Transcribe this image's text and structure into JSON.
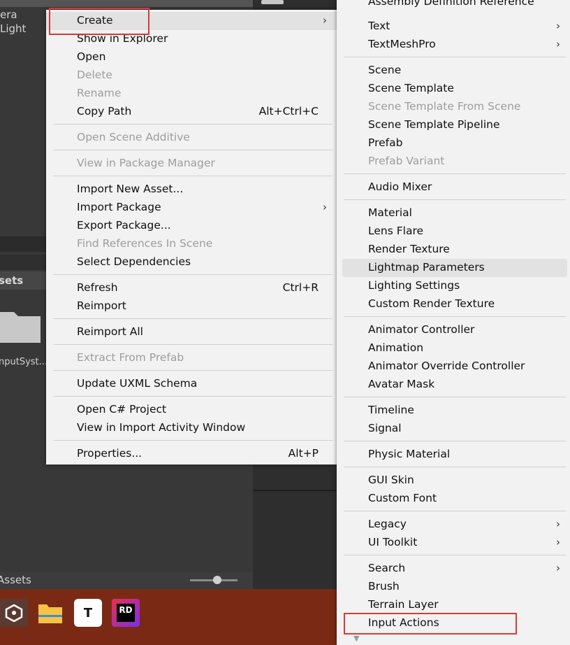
{
  "background": {
    "hierarchy_items": [
      "era",
      "Light"
    ],
    "project_header": "sets",
    "folder_label": "nputSyst...",
    "bottom_breadcrumb": "Assets"
  },
  "taskbar": {
    "icons": [
      "unity-icon",
      "folder-icon",
      "typora-icon",
      "rider-icon"
    ],
    "typora_glyph": "T",
    "rider_glyph": "RD"
  },
  "context_menu": {
    "items": [
      {
        "label": "Create",
        "submenu": true,
        "arrow": "›"
      },
      {
        "label": "Show in Explorer"
      },
      {
        "label": "Open"
      },
      {
        "label": "Delete",
        "disabled": true
      },
      {
        "label": "Rename",
        "disabled": true
      },
      {
        "label": "Copy Path",
        "shortcut": "Alt+Ctrl+C"
      },
      {
        "label": "Open Scene Additive",
        "disabled": true
      },
      {
        "label": "View in Package Manager",
        "disabled": true
      },
      {
        "label": "Import New Asset..."
      },
      {
        "label": "Import Package",
        "submenu": true,
        "arrow": "›"
      },
      {
        "label": "Export Package..."
      },
      {
        "label": "Find References In Scene",
        "disabled": true
      },
      {
        "label": "Select Dependencies"
      },
      {
        "label": "Refresh",
        "shortcut": "Ctrl+R"
      },
      {
        "label": "Reimport"
      },
      {
        "label": "Reimport All"
      },
      {
        "label": "Extract From Prefab",
        "disabled": true
      },
      {
        "label": "Update UXML Schema"
      },
      {
        "label": "Open C# Project"
      },
      {
        "label": "View in Import Activity Window"
      },
      {
        "label": "Properties...",
        "shortcut": "Alt+P"
      }
    ]
  },
  "create_submenu": {
    "items": [
      {
        "label": "Assembly Definition Reference"
      },
      {
        "label": "Text",
        "submenu": true,
        "arrow": "›"
      },
      {
        "label": "TextMeshPro",
        "submenu": true,
        "arrow": "›"
      },
      {
        "label": "Scene"
      },
      {
        "label": "Scene Template"
      },
      {
        "label": "Scene Template From Scene",
        "disabled": true
      },
      {
        "label": "Scene Template Pipeline"
      },
      {
        "label": "Prefab"
      },
      {
        "label": "Prefab Variant",
        "disabled": true
      },
      {
        "label": "Audio Mixer"
      },
      {
        "label": "Material"
      },
      {
        "label": "Lens Flare"
      },
      {
        "label": "Render Texture"
      },
      {
        "label": "Lightmap Parameters",
        "hovered": true
      },
      {
        "label": "Lighting Settings"
      },
      {
        "label": "Custom Render Texture"
      },
      {
        "label": "Animator Controller"
      },
      {
        "label": "Animation"
      },
      {
        "label": "Animator Override Controller"
      },
      {
        "label": "Avatar Mask"
      },
      {
        "label": "Timeline"
      },
      {
        "label": "Signal"
      },
      {
        "label": "Physic Material"
      },
      {
        "label": "GUI Skin"
      },
      {
        "label": "Custom Font"
      },
      {
        "label": "Legacy",
        "submenu": true,
        "arrow": "›"
      },
      {
        "label": "UI Toolkit",
        "submenu": true,
        "arrow": "›"
      },
      {
        "label": "Search",
        "submenu": true,
        "arrow": "›"
      },
      {
        "label": "Brush"
      },
      {
        "label": "Terrain Layer"
      },
      {
        "label": "Input Actions"
      }
    ],
    "scroll_down_glyph": "▼"
  }
}
